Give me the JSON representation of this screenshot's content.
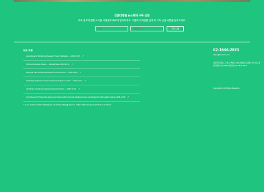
{
  "newsletter": {
    "title": "강원대병원 뉴스레터 구독 신청",
    "description": "의료 정보와 병원 소식을 이메일로 빠르게 받아보세요. 이름과 이메일을 입력 후 구독 신청 버튼을 눌러주세요.",
    "name_placeholder": "이름",
    "email_placeholder": "이메일 주소",
    "submit_label": "구독 신청"
  },
  "news": {
    "title": "보도 자료",
    "items": [
      "Hemodynamic Monitoring Research Team Publication — 2024.01.15",
      "Clinical Innovation Award — Hospital News 2024.01.12",
      "Regional Care Network Expansion Announcement — 2024.01.08",
      "Cardiology Department New Treatment Program Launch — 2023.12.27",
      "Healthcare Quality Accreditation Renewal Notice — 2023.12.19",
      "Joint Research Partnership Agreement Signed with University Medical Center and Regional Public Health Institute 2023.12.05"
    ],
    "footnote": "* 본 보도 자료의 저작권은 병원에 있으며 무단 전재 및 재배포를 금합니다. 자세한 내용은 홍보팀으로 문의해 주시기 바랍니다."
  },
  "contact": {
    "phone": "02-1644-2674",
    "email": "office@kwnuh.or.kr",
    "address": "강원특별자치도 춘천시 백령로 156 강원대학교병원 본관 1층 행정지원실 (우)24289 대표번호 02-1644-2674",
    "copyright": "Copyright (c) All Rights Reserved."
  }
}
